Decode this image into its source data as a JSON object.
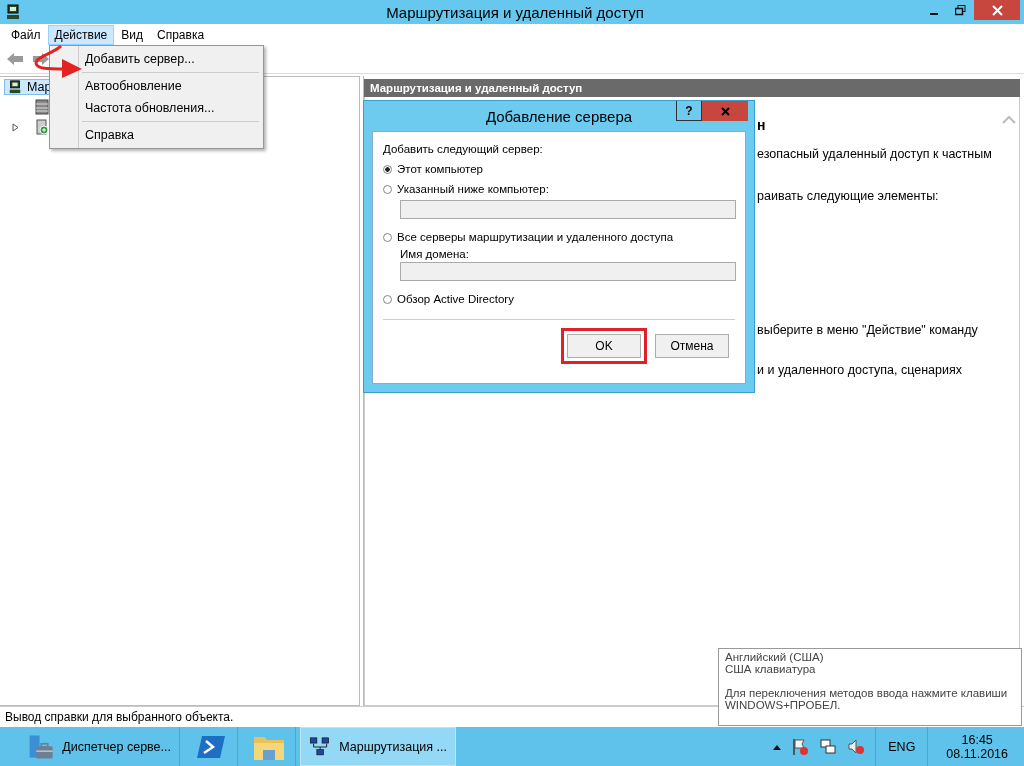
{
  "window": {
    "title": "Маршрутизация и удаленный доступ"
  },
  "menu_bar": [
    {
      "label": "Файл",
      "selected": false
    },
    {
      "label": "Действие",
      "selected": true
    },
    {
      "label": "Вид",
      "selected": false
    },
    {
      "label": "Справка",
      "selected": false
    }
  ],
  "action_menu": {
    "groups": [
      [
        "Добавить сервер..."
      ],
      [
        "Автообновление",
        "Частота обновления..."
      ],
      [
        "Справка"
      ]
    ]
  },
  "tree": [
    {
      "label": "Мар",
      "kind": "root",
      "selected": true,
      "children": [
        {
          "kind": "status"
        },
        {
          "kind": "server",
          "expanded": false
        }
      ]
    }
  ],
  "details_pane": {
    "header": "Маршрутизация и удаленный доступ",
    "heading": "н",
    "lines": [
      "езопасный удаленный доступ к частным",
      "раивать следующие элементы:",
      "выберите в меню \"Действие\" команду",
      "и и удаленного доступа, сценариях"
    ]
  },
  "dialog": {
    "title": "Добавление сервера",
    "help_label": "?",
    "prompt": "Добавить следующий сервер:",
    "options": [
      {
        "label": "Этот компьютер",
        "selected": true,
        "kind": "plain"
      },
      {
        "label": "Указанный ниже компьютер:",
        "selected": false,
        "kind": "with-field",
        "field_disabled": true
      },
      {
        "label": "Все серверы маршрутизации и удаленного доступа",
        "selected": false,
        "kind": "with-labeled-field",
        "field_label": "Имя домена:",
        "field_disabled": true
      },
      {
        "label": "Обзор Active Directory",
        "selected": false,
        "kind": "plain"
      }
    ],
    "buttons": [
      {
        "label": "OK",
        "highlighted": true
      },
      {
        "label": "Отмена",
        "highlighted": false
      }
    ]
  },
  "status_bar": "Вывод справки для выбранного объекта.",
  "language_tooltip": {
    "lines": [
      "Английский (США)",
      "США клавиатура"
    ],
    "hint": "Для переключения методов ввода нажмите клавиши WINDOWS+ПРОБЕЛ."
  },
  "taskbar": {
    "buttons": [
      {
        "kind": "server-manager",
        "label": "Диспетчер серве...",
        "selected": false
      },
      {
        "kind": "powershell",
        "selected": false
      },
      {
        "kind": "explorer",
        "selected": false
      },
      {
        "kind": "routing",
        "label": "Маршрутизация ...",
        "selected": true
      }
    ],
    "language": "ENG",
    "time": "16:45",
    "date": "08.11.2016"
  }
}
